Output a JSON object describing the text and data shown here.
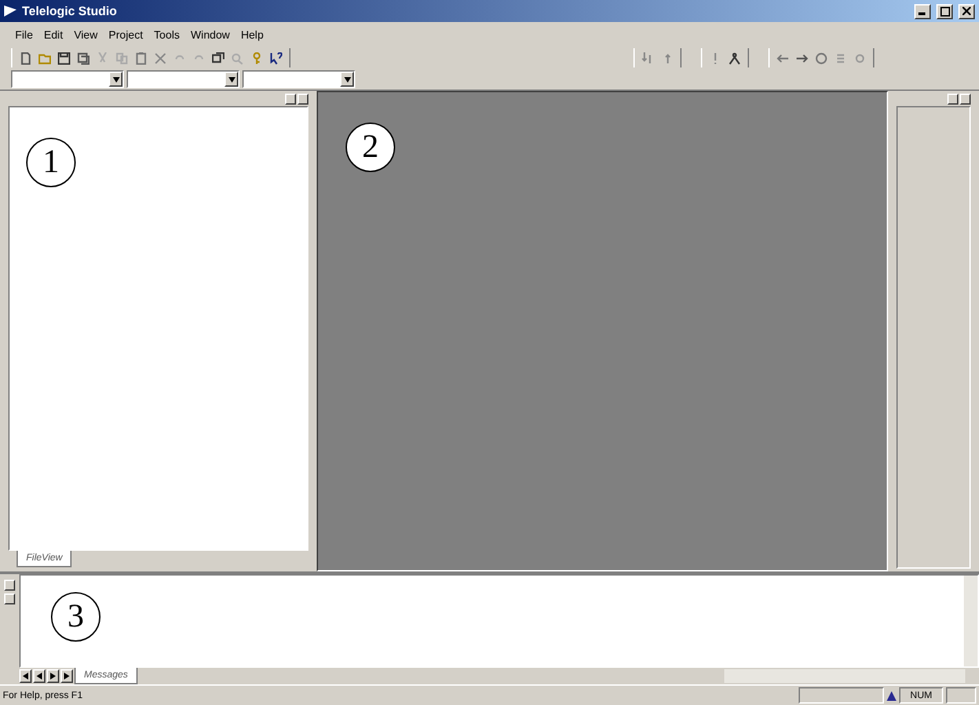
{
  "window": {
    "title": "Telelogic Studio"
  },
  "menu": [
    "File",
    "Edit",
    "View",
    "Project",
    "Tools",
    "Window",
    "Help"
  ],
  "left_pane": {
    "callout": "1",
    "tabs": [
      {
        "label": "FileView",
        "selected": true
      }
    ]
  },
  "editor_area": {
    "callout": "2"
  },
  "output_pane": {
    "callout": "3",
    "tabs": [
      {
        "label": "Messages",
        "selected": true
      }
    ]
  },
  "status_bar": {
    "message": "For Help, press F1",
    "indicator": "NUM"
  }
}
